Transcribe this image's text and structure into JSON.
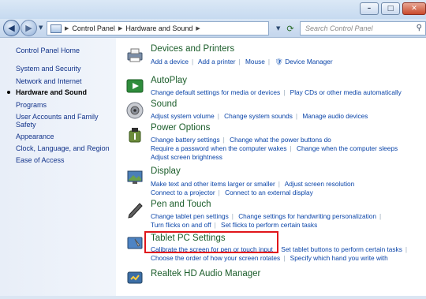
{
  "window": {
    "minimize": "–",
    "maximize": "□",
    "close": "✕"
  },
  "address": {
    "crumbs": [
      "Control Panel",
      "Hardware and Sound"
    ],
    "search_placeholder": "Search Control Panel"
  },
  "leftnav": {
    "home": "Control Panel Home",
    "items": [
      "System and Security",
      "Network and Internet",
      "Hardware and Sound",
      "Programs",
      "User Accounts and Family Safety",
      "Appearance",
      "Clock, Language, and Region",
      "Ease of Access"
    ],
    "current_index": 2
  },
  "categories": [
    {
      "title": "Devices and Printers",
      "lines": [
        [
          "Add a device",
          "Add a printer",
          "Mouse",
          "Device Manager"
        ]
      ]
    },
    {
      "title": "AutoPlay",
      "lines": [
        [
          "Change default settings for media or devices",
          "Play CDs or other media automatically"
        ]
      ]
    },
    {
      "title": "Sound",
      "lines": [
        [
          "Adjust system volume",
          "Change system sounds",
          "Manage audio devices"
        ]
      ]
    },
    {
      "title": "Power Options",
      "lines": [
        [
          "Change battery settings",
          "Change what the power buttons do"
        ],
        [
          "Require a password when the computer wakes",
          "Change when the computer sleeps"
        ],
        [
          "Adjust screen brightness"
        ]
      ]
    },
    {
      "title": "Display",
      "lines": [
        [
          "Make text and other items larger or smaller",
          "Adjust screen resolution"
        ],
        [
          "Connect to a projector",
          "Connect to an external display"
        ]
      ]
    },
    {
      "title": "Pen and Touch",
      "lines": [
        [
          "Change tablet pen settings",
          "Change settings for handwriting personalization"
        ],
        [
          "Turn flicks on and off",
          "Set flicks to perform certain tasks"
        ]
      ]
    },
    {
      "title": "Tablet PC Settings",
      "lines": [
        [
          "Calibrate the screen for pen or touch input",
          "Set tablet buttons to perform certain tasks"
        ],
        [
          "Choose the order of how your screen rotates",
          "Specify which hand you write with"
        ]
      ]
    },
    {
      "title": "Realtek HD Audio Manager",
      "lines": []
    }
  ],
  "colors": {
    "highlight": "#e0161b",
    "title_green": "#1b5d2a",
    "link_blue": "#0a44a8"
  }
}
